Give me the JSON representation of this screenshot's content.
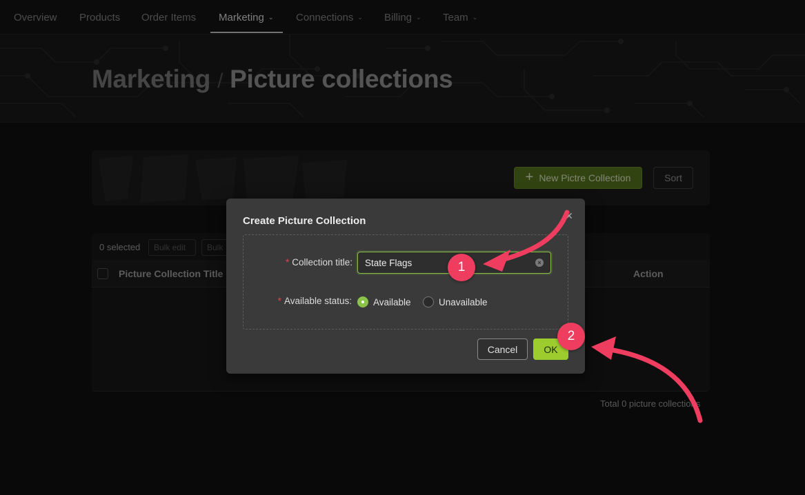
{
  "nav": {
    "items": [
      {
        "label": "Overview",
        "dropdown": false
      },
      {
        "label": "Products",
        "dropdown": false
      },
      {
        "label": "Order Items",
        "dropdown": false
      },
      {
        "label": "Marketing",
        "dropdown": true,
        "active": true
      },
      {
        "label": "Connections",
        "dropdown": true
      },
      {
        "label": "Billing",
        "dropdown": true
      },
      {
        "label": "Team",
        "dropdown": true
      }
    ]
  },
  "breadcrumb": {
    "parent": "Marketing",
    "separator": "/",
    "current": "Picture collections"
  },
  "toolbar": {
    "new_label": "New Pictre Collection",
    "sort_label": "Sort",
    "accent": "#5a7a1f"
  },
  "table": {
    "selected_text": "0 selected",
    "bulk_buttons": [
      "Bulk edit",
      "Bulk"
    ],
    "columns": [
      "Picture Collection Title",
      "Action"
    ],
    "rows": [],
    "total_text": "Total 0 picture collections"
  },
  "modal": {
    "title": "Create Picture Collection",
    "fields": {
      "title_label": "Collection title:",
      "title_value": "State Flags",
      "status_label": "Available status:",
      "status_options": [
        "Available",
        "Unavailable"
      ],
      "status_selected": "Available"
    },
    "cancel_label": "Cancel",
    "ok_label": "OK",
    "accent": "#9ccc2e"
  },
  "annotations": {
    "steps": [
      "1",
      "2"
    ],
    "color": "#ef3d5f"
  }
}
